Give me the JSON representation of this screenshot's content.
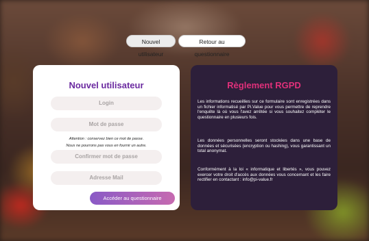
{
  "top_nav": {
    "new_user": "Nouvel utilisateur",
    "back": "Retour au questionnaire"
  },
  "form": {
    "title": "Nouvel utilisateur",
    "login_placeholder": "Login",
    "password_placeholder": "Mot de passe",
    "warning_line1": "Attention : conservez bien ce mot de passe.",
    "warning_line2": "Nous ne pourrons pas vous en fournir un autre.",
    "confirm_placeholder": "Confirmer mot de passe",
    "email_placeholder": "Adresse Mail",
    "submit": "Accéder au questionnaire"
  },
  "rgpd": {
    "title": "Règlement RGPD",
    "p1": "Les informations recueillies sur ce formulaire sont enregistrées dans un fichier informatisé par Pi.Value pour vous permettre de reprendre l'enquête là où vous l'avez arrêtée si vous souhaitez compléter le questionnaire en plusieurs fois.",
    "p2": "Les données personnelles seront stockées dans une base de données et sécurisées (encryption ou hashing), vous garantissant un total anonymat.",
    "p3": "Conformément à la loi « informatique et libertés », vous pouvez exercer votre droit d'accès aux données vous concernant et les faire rectifier en contactant : info@pi-value.fr"
  },
  "colors": {
    "form_title": "#6b2aa0",
    "rgpd_title": "#e0307a",
    "rgpd_bg": "#2d1f3a"
  }
}
